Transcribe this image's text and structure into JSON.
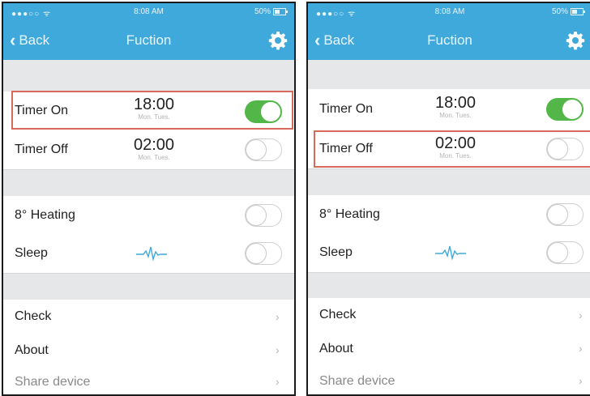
{
  "status": {
    "signal": "●●●○○ ᯤ",
    "time": "8:08 AM",
    "battery": "50%"
  },
  "nav": {
    "back_label": "Back",
    "title": "Fuction"
  },
  "timer_on": {
    "label": "Timer On",
    "time": "18:00",
    "days": "Mon. Tues."
  },
  "timer_off": {
    "label": "Timer Off",
    "time": "02:00",
    "days": "Mon. Tues."
  },
  "heating": {
    "label": "8° Heating"
  },
  "sleep": {
    "label": "Sleep"
  },
  "menu": {
    "check": "Check",
    "about": "About",
    "share": "Share device"
  },
  "colors": {
    "accent": "#3fa9dc",
    "toggle_on": "#52b748",
    "highlight": "#d76a5a",
    "background": "#e6e7e8"
  },
  "screens": [
    {
      "timer_on_enabled": true,
      "timer_off_enabled": false,
      "heating_enabled": false,
      "sleep_enabled": false,
      "highlighted_row": "Timer On"
    },
    {
      "timer_on_enabled": true,
      "timer_off_enabled": false,
      "heating_enabled": false,
      "sleep_enabled": false,
      "highlighted_row": "Timer Off"
    }
  ]
}
